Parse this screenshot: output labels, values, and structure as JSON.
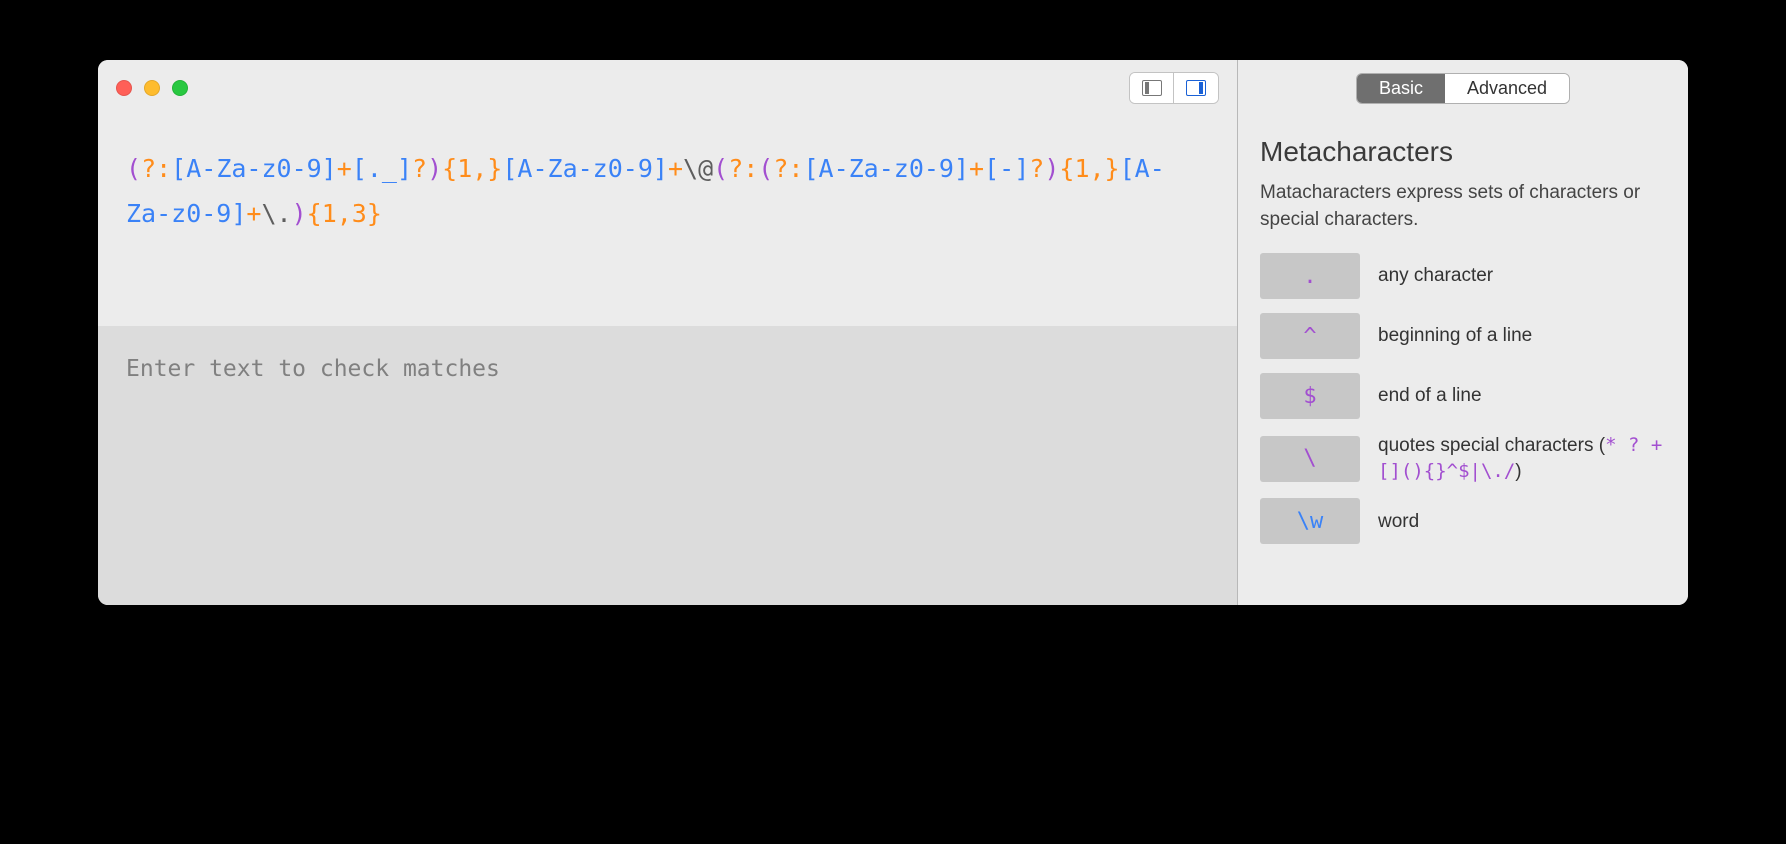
{
  "regex": {
    "tokens": [
      {
        "t": "(",
        "c": "purple"
      },
      {
        "t": "?:",
        "c": "orange"
      },
      {
        "t": "[A-Za-z0-9]",
        "c": "blue"
      },
      {
        "t": "+",
        "c": "orange"
      },
      {
        "t": "[._]",
        "c": "blue"
      },
      {
        "t": "?",
        "c": "orange"
      },
      {
        "t": ")",
        "c": "purple"
      },
      {
        "t": "{1,}",
        "c": "orange"
      },
      {
        "t": "[A-Za-z0-9]",
        "c": "blue"
      },
      {
        "t": "+",
        "c": "orange"
      },
      {
        "t": "\\@",
        "c": "gray"
      },
      {
        "t": "(",
        "c": "purple"
      },
      {
        "t": "?:",
        "c": "orange"
      },
      {
        "t": "(",
        "c": "purple"
      },
      {
        "t": "?:",
        "c": "orange"
      },
      {
        "t": "[A-Za-z0-9]",
        "c": "blue"
      },
      {
        "t": "+",
        "c": "orange"
      },
      {
        "t": "[-]",
        "c": "blue"
      },
      {
        "t": "?",
        "c": "orange"
      },
      {
        "t": ")",
        "c": "purple"
      },
      {
        "t": "{1,}",
        "c": "orange"
      },
      {
        "t": "[A-Za-z0-9]",
        "c": "blue"
      },
      {
        "t": "+",
        "c": "orange"
      },
      {
        "t": "\\.",
        "c": "gray"
      },
      {
        "t": ")",
        "c": "purple"
      },
      {
        "t": "{1,3}",
        "c": "orange"
      }
    ]
  },
  "match_area": {
    "placeholder": "Enter text to check matches"
  },
  "segmented": {
    "basic": "Basic",
    "advanced": "Advanced"
  },
  "sidebar": {
    "title": "Metacharacters",
    "description": "Matacharacters express sets of characters or special characters.",
    "items": [
      {
        "symbol": ".",
        "symbol_class": "sym-purple",
        "label_html": "any character"
      },
      {
        "symbol": "^",
        "symbol_class": "sym-purple",
        "label_html": "beginning of a line"
      },
      {
        "symbol": "$",
        "symbol_class": "sym-purple",
        "label_html": "end of a line"
      },
      {
        "symbol": "\\",
        "symbol_class": "sym-purple",
        "label_html": "quotes special characters (<span class=\"code-purple\">* ? +[](){}^$|\\./</span>)"
      },
      {
        "symbol": "\\w",
        "symbol_class": "sym-blue",
        "label_html": "word"
      }
    ]
  }
}
